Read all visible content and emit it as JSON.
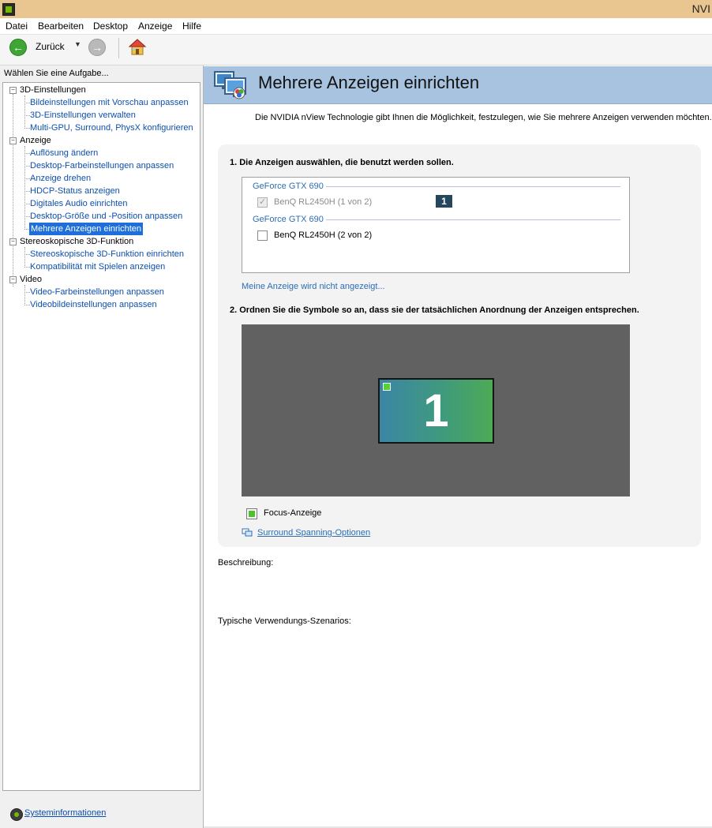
{
  "window": {
    "title": "NVI"
  },
  "menu": [
    "Datei",
    "Bearbeiten",
    "Desktop",
    "Anzeige",
    "Hilfe"
  ],
  "toolbar": {
    "back_label": "Zurück"
  },
  "sidebar": {
    "header": "Wählen Sie eine Aufgabe...",
    "groups": [
      {
        "label": "3D-Einstellungen",
        "items": [
          "Bildeinstellungen mit Vorschau anpassen",
          "3D-Einstellungen verwalten",
          "Multi-GPU, Surround, PhysX konfigurieren"
        ]
      },
      {
        "label": "Anzeige",
        "items": [
          "Auflösung ändern",
          "Desktop-Farbeinstellungen anpassen",
          "Anzeige drehen",
          "HDCP-Status anzeigen",
          "Digitales Audio einrichten",
          "Desktop-Größe und -Position anpassen",
          "Mehrere Anzeigen einrichten"
        ]
      },
      {
        "label": "Stereoskopische 3D-Funktion",
        "items": [
          "Stereoskopische 3D-Funktion einrichten",
          "Kompatibilität mit Spielen anzeigen"
        ]
      },
      {
        "label": "Video",
        "items": [
          "Video-Farbeinstellungen anpassen",
          "Videobildeinstellungen anpassen"
        ]
      }
    ],
    "selected_item": "Mehrere Anzeigen einrichten",
    "system_info": "Systeminformationen"
  },
  "main": {
    "title": "Mehrere Anzeigen einrichten",
    "subtitle": "Die NVIDIA nView Technologie gibt Ihnen die Möglichkeit, festzulegen, wie Sie mehrere Anzeigen verwenden möchten.",
    "step1": "1. Die Anzeigen auswählen, die benutzt werden sollen.",
    "gpus": [
      {
        "name": "GeForce GTX 690",
        "monitor": "BenQ RL2450H (1 von 2)",
        "checked": true,
        "enabled": false,
        "badge": "1"
      },
      {
        "name": "GeForce GTX 690",
        "monitor": "BenQ RL2450H (2 von 2)",
        "checked": false,
        "enabled": true
      }
    ],
    "not_shown_link": "Meine Anzeige wird nicht angezeigt...",
    "step2": "2. Ordnen Sie die Symbole so an, dass sie der tatsächlichen Anordnung der Anzeigen entsprechen.",
    "arrangement": {
      "monitor_number": "1"
    },
    "focus_legend": "Focus-Anzeige",
    "surround_link": "Surround Spanning-Optionen",
    "description_label": "Beschreibung:",
    "usage_label": "Typische Verwendungs-Szenarios:"
  },
  "colors": {
    "header_band": "#a7c3df",
    "link": "#2c6db4",
    "selection": "#1e6fd9",
    "nvidia_green": "#76b900",
    "title_bar": "#e9c58f"
  }
}
